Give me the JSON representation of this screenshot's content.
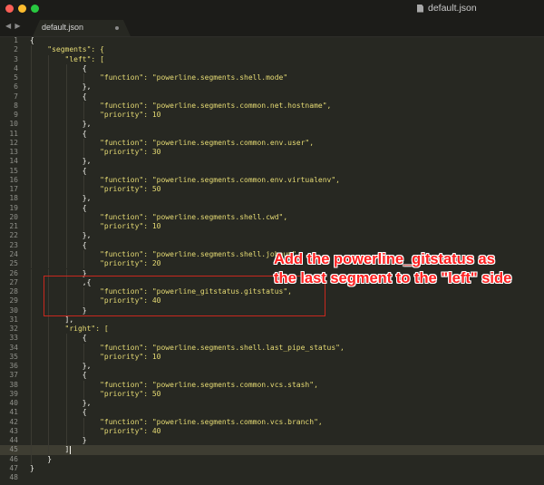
{
  "window": {
    "title": "default.json",
    "icon": "file-icon"
  },
  "tabs": [
    {
      "label": "default.json",
      "modified": true
    }
  ],
  "nav": {
    "back": "◀",
    "forward": "▶"
  },
  "editor": {
    "active_line": 45,
    "lines": [
      "{",
      "    \"segments\": {",
      "        \"left\": [",
      "            {",
      "                \"function\": \"powerline.segments.shell.mode\"",
      "            },",
      "            {",
      "                \"function\": \"powerline.segments.common.net.hostname\",",
      "                \"priority\": 10",
      "            },",
      "            {",
      "                \"function\": \"powerline.segments.common.env.user\",",
      "                \"priority\": 30",
      "            },",
      "            {",
      "                \"function\": \"powerline.segments.common.env.virtualenv\",",
      "                \"priority\": 50",
      "            },",
      "            {",
      "                \"function\": \"powerline.segments.shell.cwd\",",
      "                \"priority\": 10",
      "            },",
      "            {",
      "                \"function\": \"powerline.segments.shell.jobnum\",",
      "                \"priority\": 20",
      "            }",
      "            ,{",
      "                \"function\": \"powerline_gitstatus.gitstatus\",",
      "                \"priority\": 40",
      "            }",
      "        ],",
      "        \"right\": [",
      "            {",
      "                \"function\": \"powerline.segments.shell.last_pipe_status\",",
      "                \"priority\": 10",
      "            },",
      "            {",
      "                \"function\": \"powerline.segments.common.vcs.stash\",",
      "                \"priority\": 50",
      "            },",
      "            {",
      "                \"function\": \"powerline.segments.common.vcs.branch\",",
      "                \"priority\": 40",
      "            }",
      "        ]",
      "    }",
      "}",
      ""
    ]
  },
  "annotation": {
    "line1": "Add the powerline_gitstatus as",
    "line2": "the last segment to the \"left\" side",
    "color": "#ff1f1f"
  }
}
